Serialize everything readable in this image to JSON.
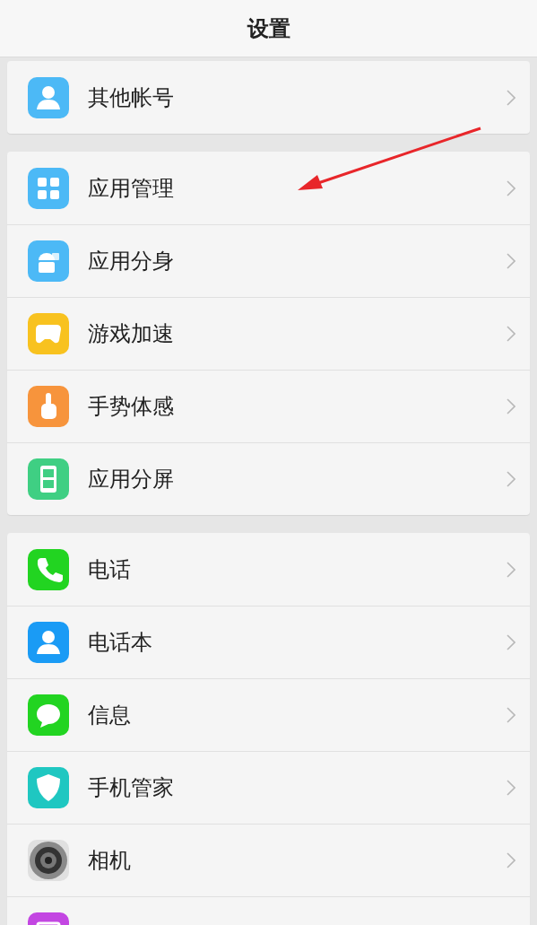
{
  "title": "设置",
  "groups": [
    {
      "items": [
        {
          "label": "其他帐号",
          "kind": "account",
          "color": "#4cb9f6"
        }
      ]
    },
    {
      "items": [
        {
          "label": "应用管理",
          "kind": "apps",
          "color": "#4cb9f6"
        },
        {
          "label": "应用分身",
          "kind": "clone",
          "color": "#4cb9f6"
        },
        {
          "label": "游戏加速",
          "kind": "game",
          "color": "#f8c21f"
        },
        {
          "label": "手势体感",
          "kind": "gesture",
          "color": "#f7943c"
        },
        {
          "label": "应用分屏",
          "kind": "split",
          "color": "#3fcf83"
        }
      ]
    },
    {
      "items": [
        {
          "label": "电话",
          "kind": "phone",
          "color": "#22d421"
        },
        {
          "label": "电话本",
          "kind": "contacts",
          "color": "#1a9bf5"
        },
        {
          "label": "信息",
          "kind": "message",
          "color": "#22d421"
        },
        {
          "label": "手机管家",
          "kind": "shield",
          "color": "#1fc7c1"
        },
        {
          "label": "相机",
          "kind": "camera",
          "color": "#8a8a8a"
        },
        {
          "kind": "album",
          "color": "#c346e2"
        }
      ]
    }
  ]
}
